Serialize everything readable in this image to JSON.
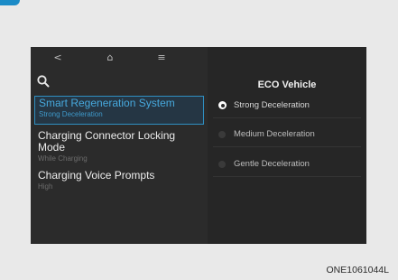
{
  "nav": {
    "back_icon": "<",
    "home_icon": "⌂",
    "menu_icon": "≡"
  },
  "menu": {
    "items": [
      {
        "title": "Smart Regeneration System",
        "subtitle": "Strong Deceleration",
        "selected": true
      },
      {
        "title": "Charging Connector Locking Mode",
        "subtitle": "While Charging",
        "selected": false
      },
      {
        "title": "Charging Voice Prompts",
        "subtitle": "High",
        "selected": false
      }
    ]
  },
  "panel": {
    "title": "ECO Vehicle",
    "options": [
      {
        "label": "Strong Deceleration",
        "checked": true
      },
      {
        "label": "Medium Deceleration",
        "checked": false
      },
      {
        "label": "Gentle Deceleration",
        "checked": false
      }
    ]
  },
  "caption": "ONE1061044L",
  "colors": {
    "accent": "#2f8fc1",
    "screen_bg": "#2b2b2b",
    "page_bg": "#e9e9e9"
  }
}
